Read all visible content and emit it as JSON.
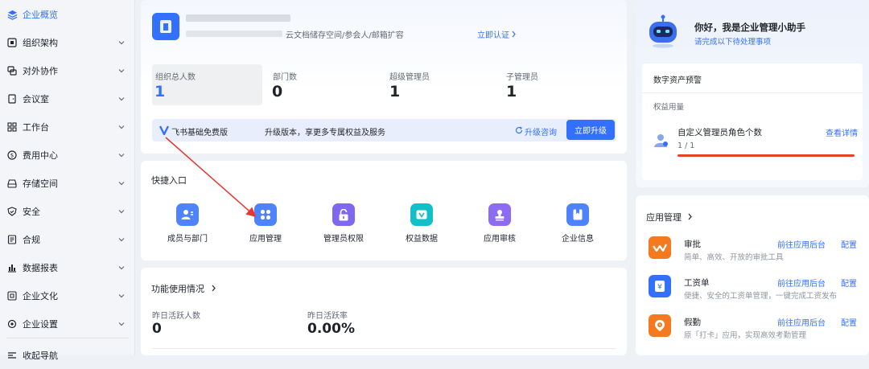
{
  "sidebar": {
    "items": [
      {
        "label": "企业概览",
        "icon": "layers-icon"
      },
      {
        "label": "组织架构",
        "icon": "org-icon"
      },
      {
        "label": "对外协作",
        "icon": "collab-icon"
      },
      {
        "label": "会议室",
        "icon": "door-icon"
      },
      {
        "label": "工作台",
        "icon": "grid-icon"
      },
      {
        "label": "费用中心",
        "icon": "dollar-icon"
      },
      {
        "label": "存储空间",
        "icon": "drive-icon"
      },
      {
        "label": "安全",
        "icon": "shield-icon"
      },
      {
        "label": "合规",
        "icon": "doc-icon"
      },
      {
        "label": "数据报表",
        "icon": "bar-chart-icon"
      },
      {
        "label": "企业文化",
        "icon": "culture-icon"
      },
      {
        "label": "企业设置",
        "icon": "gear-icon"
      },
      {
        "label": "收起导航",
        "icon": "collapse-icon"
      }
    ]
  },
  "org": {
    "desc_tail": "云文档储存空间/参会人/邮箱扩容",
    "verify_link": "立即认证",
    "stats": [
      {
        "label": "组织总人数",
        "value": "1"
      },
      {
        "label": "部门数",
        "value": "0"
      },
      {
        "label": "超级管理员",
        "value": "1"
      },
      {
        "label": "子管理员",
        "value": "1"
      }
    ],
    "plan": "飞书基础免费版",
    "upgrade_text": "升级版本，享更多专属权益及服务",
    "consult": "升级咨询",
    "upgrade_btn": "立即升级"
  },
  "quick": {
    "title": "快捷入口",
    "items": [
      {
        "label": "成员与部门",
        "color": "#4e83fd"
      },
      {
        "label": "应用管理",
        "color": "#4e83fd"
      },
      {
        "label": "管理员权限",
        "color": "#7f67ef"
      },
      {
        "label": "权益数据",
        "color": "#14c0c8"
      },
      {
        "label": "应用审核",
        "color": "#8d6bf2"
      },
      {
        "label": "企业信息",
        "color": "#4e83fd"
      }
    ]
  },
  "usage": {
    "title": "功能使用情况",
    "stats": [
      {
        "label": "昨日活跃人数",
        "value": "0"
      },
      {
        "label": "昨日活跃率",
        "value": "0.00%"
      }
    ]
  },
  "assistant": {
    "title": "你好，我是企业管理小助手",
    "subtitle": "请完成以下待处理事项",
    "section": "数字资产预警",
    "subsection": "权益用量",
    "item_title": "自定义管理员角色个数",
    "item_count": "1 / 1",
    "item_link": "查看详情"
  },
  "apps": {
    "title": "应用管理",
    "list": [
      {
        "name": "审批",
        "desc": "简单、高效、开放的审批工具",
        "link1": "前往应用后台",
        "link2": "配置",
        "color": "#f57a1f",
        "icon": "approval-icon"
      },
      {
        "name": "工资单",
        "desc": "便捷、安全的工资单管理，一键完成工资发布",
        "link1": "前往应用后台",
        "link2": "配置",
        "color": "#3370ff",
        "icon": "payroll-icon"
      },
      {
        "name": "假勤",
        "desc": "原「打卡」应用，实现高效考勤管理",
        "link1": "前往应用后台",
        "link2": "配置",
        "color": "#f57a1f",
        "icon": "attendance-icon"
      }
    ]
  },
  "colors": {
    "accent": "#3370ff",
    "annotation_arrow": "#e8362f",
    "warning_bar": "#e8432a"
  }
}
